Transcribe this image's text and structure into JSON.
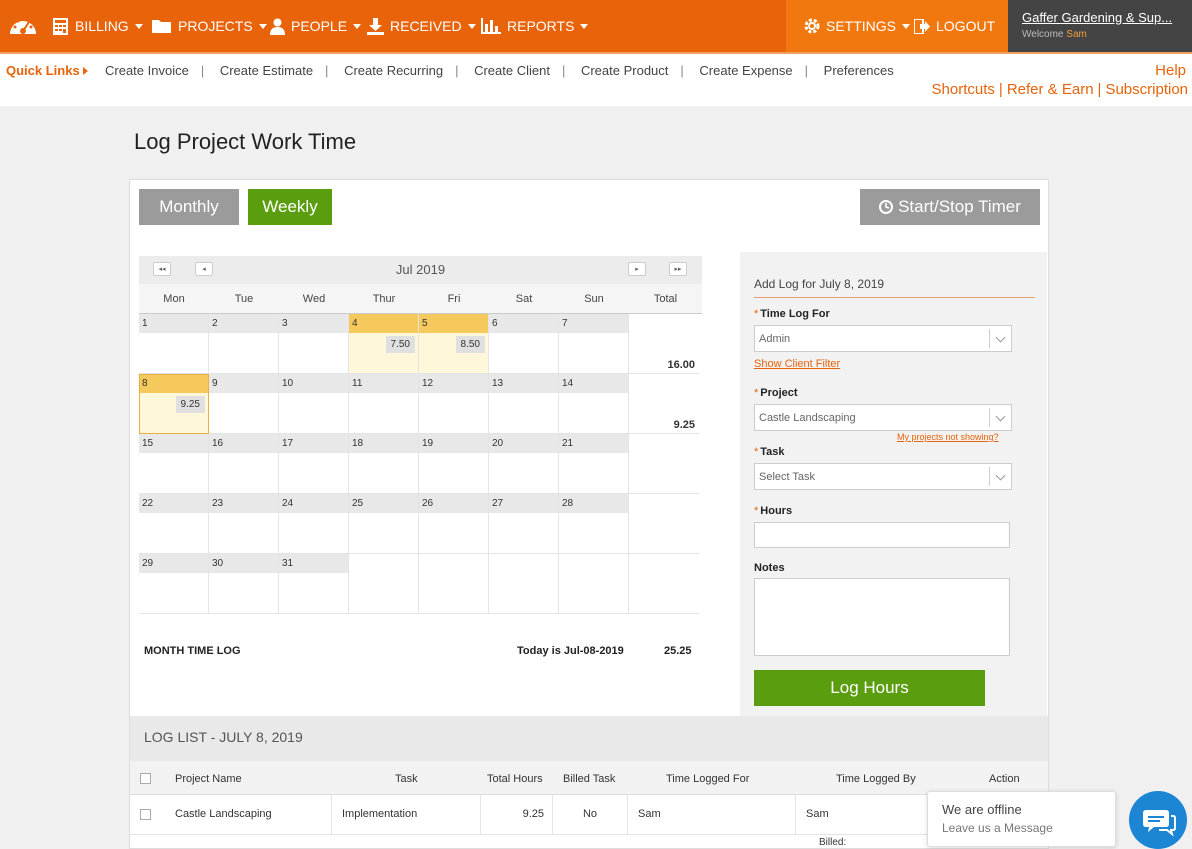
{
  "nav": {
    "items": [
      {
        "label": "BILLING",
        "icon": "calculator-icon"
      },
      {
        "label": "PROJECTS",
        "icon": "folder-icon"
      },
      {
        "label": "PEOPLE",
        "icon": "person-icon"
      },
      {
        "label": "RECEIVED",
        "icon": "download-icon"
      },
      {
        "label": "REPORTS",
        "icon": "bar-chart-icon"
      }
    ],
    "settings": "SETTINGS",
    "logout": "LOGOUT",
    "account_name": "Gaffer Gardening & Sup...",
    "welcome": "Welcome",
    "user": "Sam"
  },
  "quicklinks": {
    "title": "Quick Links",
    "links": [
      "Create Invoice",
      "Create Estimate",
      "Create Recurring",
      "Create Client",
      "Create Product",
      "Create Expense",
      "Preferences"
    ],
    "help": "Help",
    "right_links": [
      "Shortcuts",
      "Refer & Earn",
      "Subscription"
    ]
  },
  "page": {
    "title": "Log Project Work Time"
  },
  "toolbar": {
    "monthly": "Monthly",
    "weekly": "Weekly",
    "timer": "Start/Stop Timer"
  },
  "calendar": {
    "month": "Jul 2019",
    "days_of_week": [
      "Mon",
      "Tue",
      "Wed",
      "Thur",
      "Fri",
      "Sat",
      "Sun"
    ],
    "total_label": "Total",
    "weeks": [
      {
        "days": [
          "1",
          "2",
          "3",
          "4",
          "5",
          "6",
          "7"
        ],
        "hours": [
          "",
          "",
          "",
          "7.50",
          "8.50",
          "",
          ""
        ],
        "total": "16.00"
      },
      {
        "days": [
          "8",
          "9",
          "10",
          "11",
          "12",
          "13",
          "14"
        ],
        "hours": [
          "9.25",
          "",
          "",
          "",
          "",
          "",
          ""
        ],
        "total": "9.25"
      },
      {
        "days": [
          "15",
          "16",
          "17",
          "18",
          "19",
          "20",
          "21"
        ],
        "hours": [
          "",
          "",
          "",
          "",
          "",
          "",
          ""
        ],
        "total": ""
      },
      {
        "days": [
          "22",
          "23",
          "24",
          "25",
          "26",
          "27",
          "28"
        ],
        "hours": [
          "",
          "",
          "",
          "",
          "",
          "",
          ""
        ],
        "total": ""
      },
      {
        "days": [
          "29",
          "30",
          "31",
          "",
          "",
          "",
          ""
        ],
        "hours": [
          "",
          "",
          "",
          "",
          "",
          "",
          ""
        ],
        "total": ""
      }
    ],
    "month_time_log_label": "MONTH TIME LOG",
    "today_label": "Today is Jul-08-2019",
    "month_total": "25.25"
  },
  "form": {
    "title": "Add Log for July 8, 2019",
    "time_log_for_label": "Time Log For",
    "time_log_for_value": "Admin",
    "show_client_filter": "Show Client Filter",
    "project_label": "Project",
    "project_value": "Castle Landscaping",
    "projects_missing": "My projects not showing?",
    "task_label": "Task",
    "task_placeholder": "Select Task",
    "hours_label": "Hours",
    "notes_label": "Notes",
    "submit": "Log Hours"
  },
  "loglist": {
    "title": "LOG LIST - JULY 8, 2019",
    "columns": [
      "Project Name",
      "Task",
      "Total Hours",
      "Billed Task",
      "Time Logged For",
      "Time Logged By",
      "Action"
    ],
    "rows": [
      {
        "project": "Castle Landscaping",
        "task": "Implementation",
        "hours": "9.25",
        "billed": "No",
        "for": "Sam",
        "by": "Sam"
      }
    ],
    "billed_label": "Billed:"
  },
  "chat": {
    "status": "We are offline",
    "cta": "Leave us a Message"
  },
  "colors": {
    "brand": "#e8630a",
    "green": "#5a9e0f",
    "chat": "#1d86d4"
  }
}
